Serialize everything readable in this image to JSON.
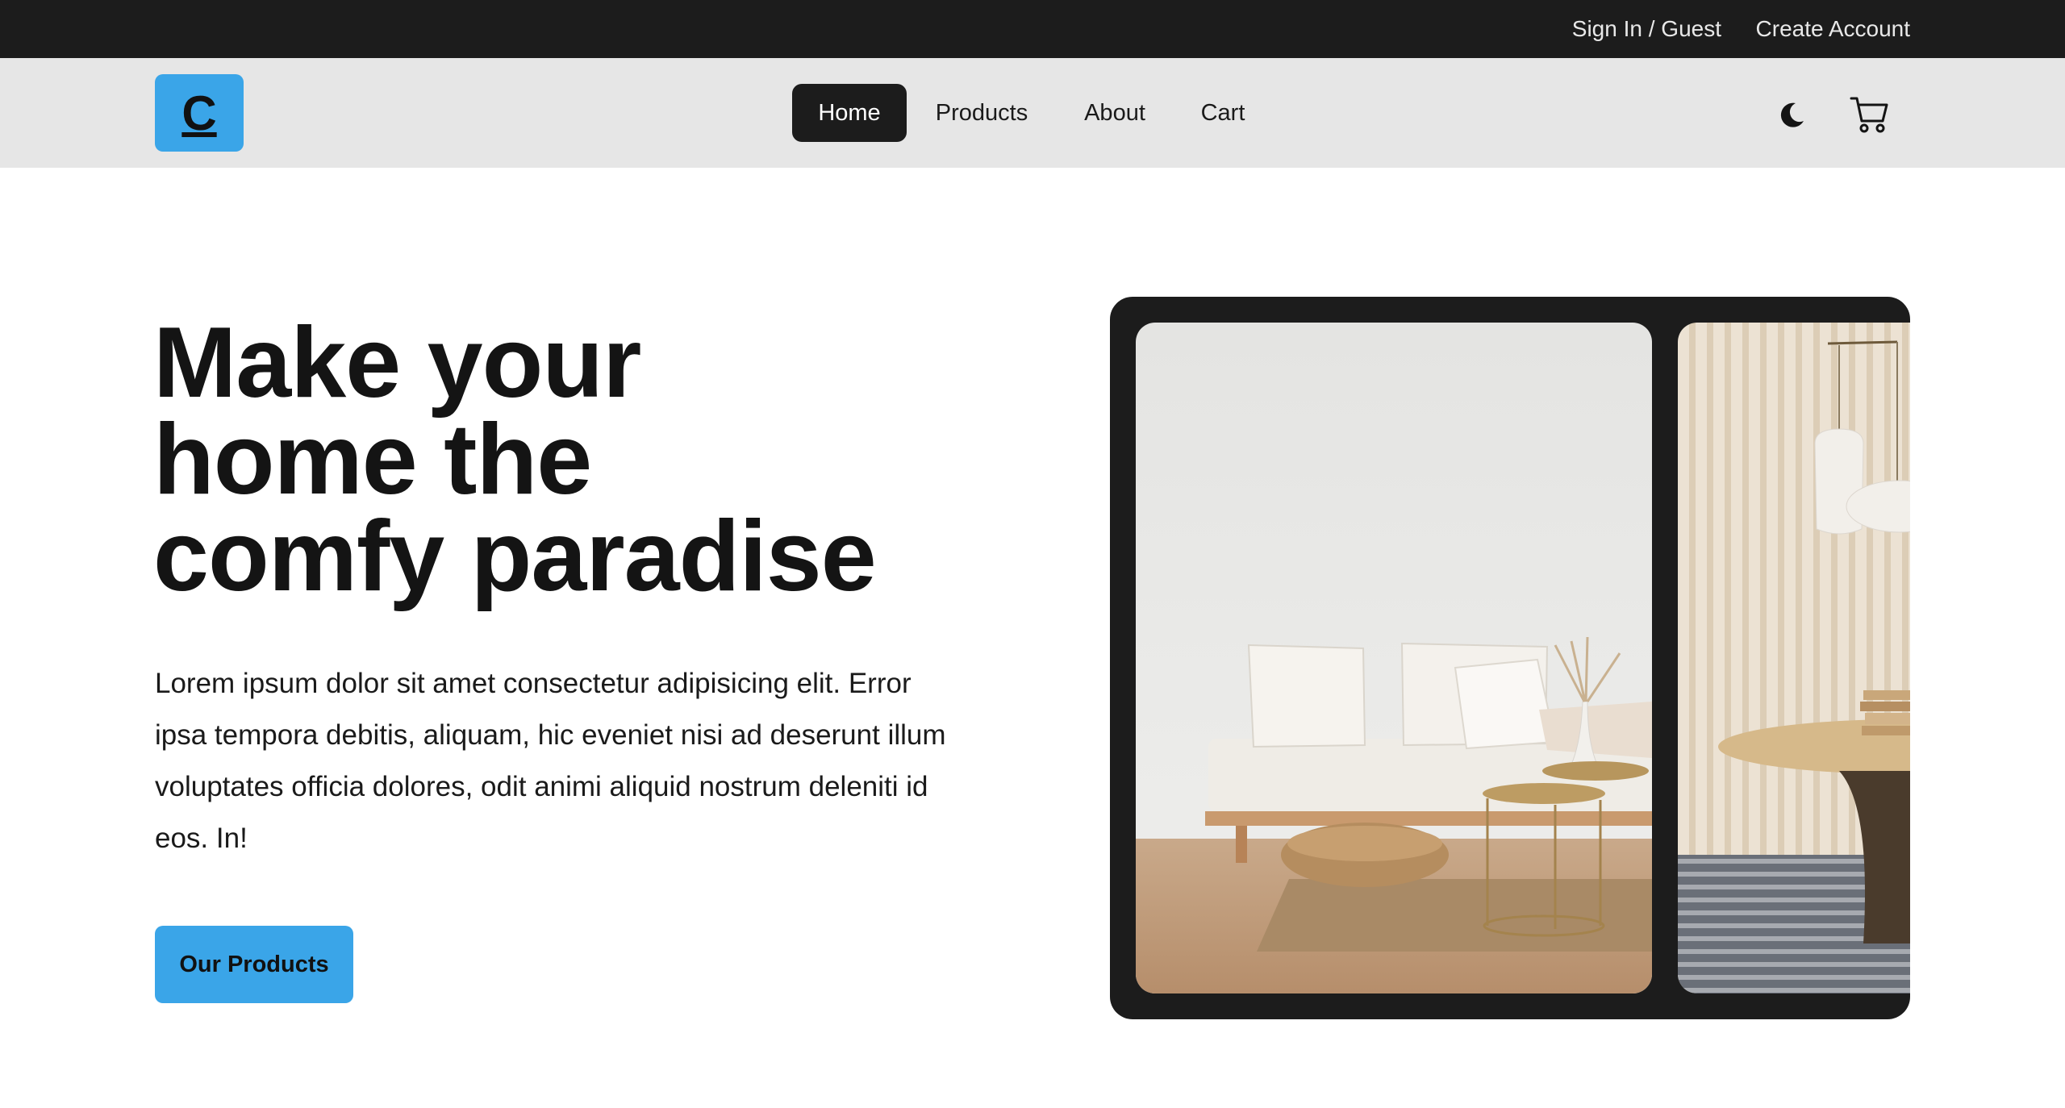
{
  "topbar": {
    "signin": "Sign In / Guest",
    "create_account": "Create Account"
  },
  "nav": {
    "logo": "C",
    "links": [
      "Home",
      "Products",
      "About",
      "Cart"
    ],
    "active": "Home"
  },
  "icons": {
    "theme": "moon-icon",
    "cart": "cart-icon"
  },
  "hero": {
    "title_lines": [
      "Make your",
      "home the",
      "comfy paradise"
    ],
    "text": "Lorem ipsum dolor sit amet consectetur adipisicing elit. Error ipsa tempora debitis, aliquam, hic eveniet nisi ad deserunt illum voluptates officia dolores, odit animi aliquid nostrum deleniti id eos. In!",
    "cta": "Our Products"
  },
  "colors": {
    "accent": "#3aa5e8",
    "dark": "#1c1c1c",
    "navbar": "#e6e6e6"
  }
}
